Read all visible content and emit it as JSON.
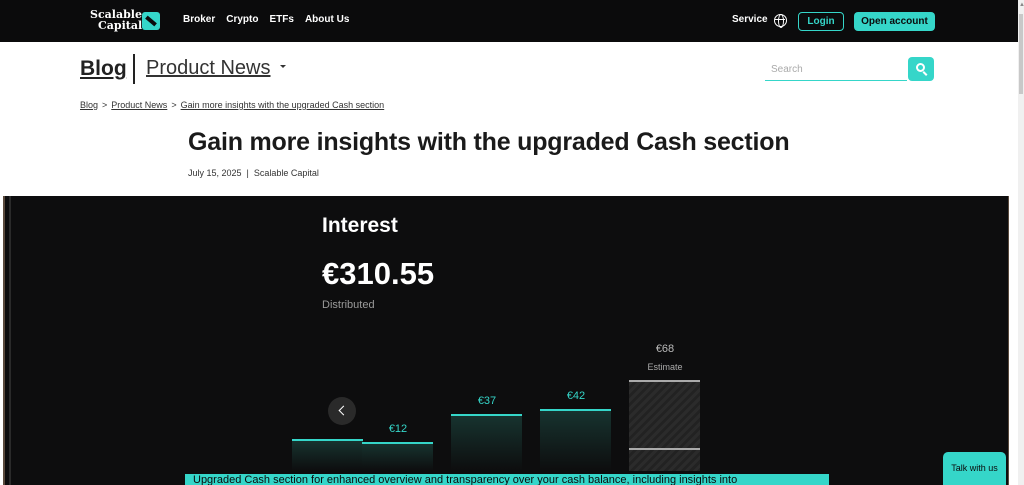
{
  "nav": {
    "logo_line1": "Scalable",
    "logo_line2": "Capital",
    "links": [
      "Broker",
      "Crypto",
      "ETFs",
      "About Us"
    ],
    "service": "Service",
    "login": "Login",
    "open_account": "Open account"
  },
  "blog_header": {
    "blog": "Blog",
    "category": "Product News",
    "search_placeholder": "Search"
  },
  "breadcrumb": [
    "Blog",
    "Product News",
    "Gain more insights with the upgraded Cash section"
  ],
  "breadcrumb_sep": ">",
  "article": {
    "title": "Gain more insights with the upgraded Cash section",
    "date": "July 15, 2025",
    "meta_sep": "|",
    "author": "Scalable Capital"
  },
  "hero": {
    "heading": "Interest",
    "amount": "€310.55",
    "amount_sub": "Distributed",
    "caption": "Upgraded Cash section for enhanced overview and transparency over your cash balance, including insights into"
  },
  "chart_data": {
    "type": "bar",
    "categories": [
      "",
      "",
      "",
      "",
      ""
    ],
    "values": [
      null,
      12,
      37,
      42,
      68
    ],
    "labels": [
      "",
      "€12",
      "€37",
      "€42",
      "€68"
    ],
    "estimate_label": "Estimate",
    "estimate_index": 4
  },
  "talk_button": "Talk with us",
  "colors": {
    "accent": "#35d6c9",
    "dark": "#0b0b0c"
  }
}
